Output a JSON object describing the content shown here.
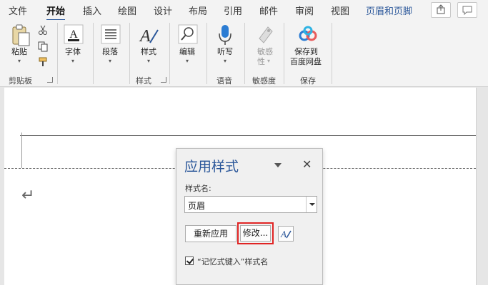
{
  "tabs": [
    "文件",
    "开始",
    "插入",
    "绘图",
    "设计",
    "布局",
    "引用",
    "邮件",
    "审阅",
    "视图",
    "页眉和页脚"
  ],
  "active_tab": "开始",
  "ribbon": {
    "paste": "粘贴",
    "font": "字体",
    "paragraph": "段落",
    "styles": "样式",
    "editing": "编辑",
    "dictate": "听写",
    "sensitivity": "敏感",
    "sensitivity2": "性",
    "save_baidu": "保存到",
    "save_baidu2": "百度网盘",
    "group_clipboard": "剪贴板",
    "group_styles": "样式",
    "group_voice": "语音",
    "group_sensitivity": "敏感度",
    "group_save": "保存"
  },
  "pane": {
    "title": "应用样式",
    "close": "✕",
    "style_name_label": "样式名:",
    "style_name_value": "页眉",
    "reapply": "重新应用",
    "modify": "修改...",
    "autocomplete_label": "“记忆式键入”样式名",
    "autocomplete_checked": true
  },
  "colors": {
    "accent": "#2b579a",
    "highlight": "#e02424"
  },
  "icons": [
    "share-icon",
    "comment-icon",
    "paste-icon",
    "cut-icon",
    "copy-icon",
    "format-painter-icon",
    "font-icon",
    "paragraph-icon",
    "styles-icon",
    "search-icon",
    "microphone-icon",
    "sensitivity-icon",
    "cloud-icon",
    "paragraph-mark-icon",
    "styles-pane-icon",
    "checkbox-icon"
  ]
}
